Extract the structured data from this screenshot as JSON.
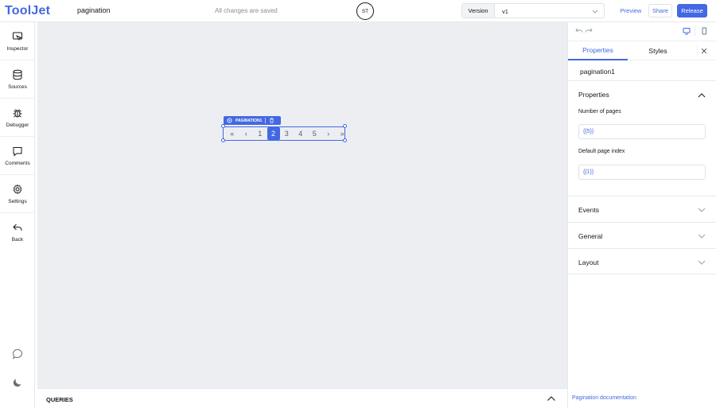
{
  "header": {
    "logo": "ToolJet",
    "app_name": "pagination",
    "save_status": "All changes are saved",
    "avatar_initials": "ST",
    "version_label": "Version",
    "version_value": "v1",
    "preview_label": "Preview",
    "share_label": "Share",
    "release_label": "Release"
  },
  "sidebar": {
    "items": [
      {
        "label": "Inspector",
        "icon": "inspector-icon"
      },
      {
        "label": "Sources",
        "icon": "database-icon"
      },
      {
        "label": "Debugger",
        "icon": "bug-icon"
      },
      {
        "label": "Comments",
        "icon": "comment-icon"
      },
      {
        "label": "Settings",
        "icon": "gear-icon"
      },
      {
        "label": "Back",
        "icon": "back-arrow-icon"
      }
    ],
    "bottom_icons": [
      "chat-icon",
      "moon-icon"
    ]
  },
  "canvas": {
    "widget_tag": "PAGINATION1",
    "pagination": {
      "first": "«",
      "prev": "‹",
      "pages": [
        "1",
        "2",
        "3",
        "4",
        "5"
      ],
      "active_page": "2",
      "next": "›",
      "last": "»"
    }
  },
  "queries": {
    "label": "QUERIES"
  },
  "inspector": {
    "tabs": [
      "Properties",
      "Styles"
    ],
    "component_name": "pagination1",
    "sections": {
      "properties": {
        "title": "Properties",
        "fields": [
          {
            "label": "Number of pages",
            "value": "{{5}}"
          },
          {
            "label": "Default page index",
            "value": "{{1}}"
          }
        ]
      },
      "events": "Events",
      "general": "General",
      "layout": "Layout"
    },
    "doc_link": "Pagination documentation"
  },
  "colors": {
    "accent": "#4368e3",
    "canvas_bg": "#eceef2",
    "text": "#11181c"
  }
}
